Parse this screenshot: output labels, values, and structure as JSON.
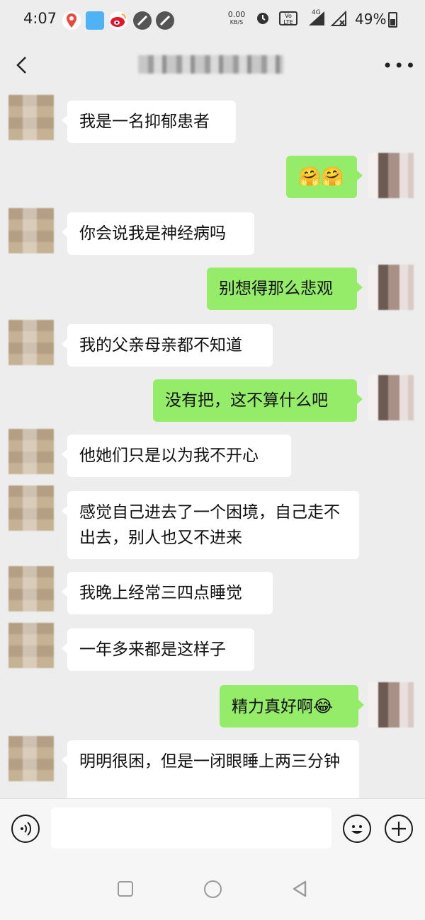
{
  "status_bar": {
    "time": "4:07",
    "net_speed": "0.00",
    "net_unit": "KB/S",
    "signal": "4G",
    "lte_label": "LTE",
    "battery_percent": "49%",
    "battery_level": 0.49,
    "icons": [
      "map-pin-icon",
      "news-app-icon",
      "weibo-icon",
      "blocked-icon",
      "blocked-icon",
      "alarm-icon",
      "lte-icon",
      "signal-icon",
      "no-signal-icon",
      "battery-icon"
    ]
  },
  "header": {
    "title": "▇ ▇▇ ▇ ▇▇▇▇▇",
    "icons": [
      "back-icon",
      "more-icon"
    ]
  },
  "messages": [
    {
      "side": "left",
      "text": "我是一名抑郁患者"
    },
    {
      "side": "right",
      "text": "🤗🤗"
    },
    {
      "side": "left",
      "text": "你会说我是神经病吗"
    },
    {
      "side": "right",
      "text": "别想得那么悲观"
    },
    {
      "side": "left",
      "text": "我的父亲母亲都不知道"
    },
    {
      "side": "right",
      "text": "没有把，这不算什么吧"
    },
    {
      "side": "left",
      "text": "他她们只是以为我不开心"
    },
    {
      "side": "left",
      "text": "感觉自己进去了一个困境，自己走不出去，别人也又不进来"
    },
    {
      "side": "left",
      "text": "我晚上经常三四点睡觉"
    },
    {
      "side": "left",
      "text": "一年多来都是这样子"
    },
    {
      "side": "right",
      "text": "精力真好啊",
      "emoji": "😂"
    },
    {
      "side": "left",
      "text": "明明很困，但是一闭眼睡上两三分钟"
    }
  ],
  "input_bar": {
    "placeholder": "",
    "icons": [
      "voice-icon",
      "emoji-icon",
      "add-icon"
    ]
  },
  "nav_bar": {
    "icons": [
      "recent-apps-icon",
      "home-icon",
      "back-nav-icon"
    ]
  },
  "colors": {
    "background": "#ededed",
    "bubble_self": "#95ec69",
    "bubble_other": "#ffffff"
  }
}
